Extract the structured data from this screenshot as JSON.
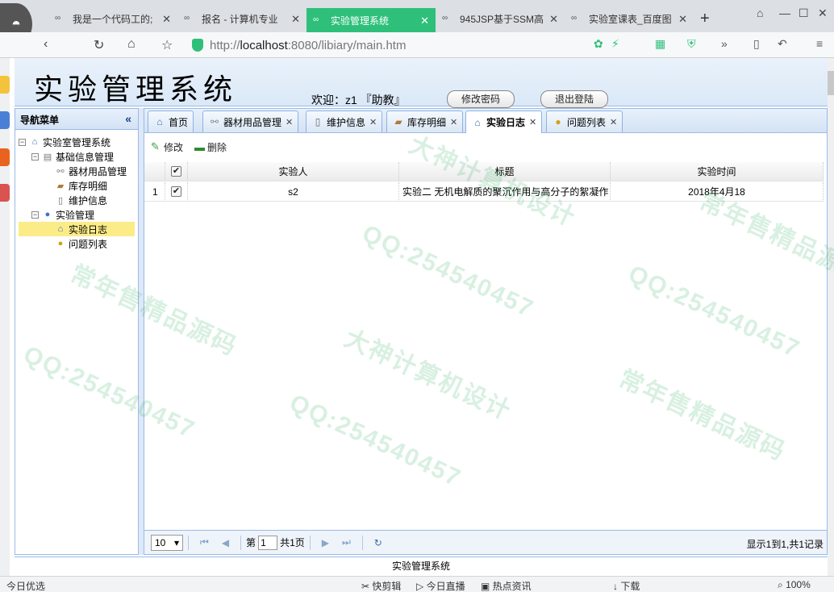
{
  "browser": {
    "tabs": [
      {
        "label": "我是一个代码工的;"
      },
      {
        "label": "报名 - 计算机专业"
      },
      {
        "label": "实验管理系统"
      },
      {
        "label": "945JSP基于SSM高"
      },
      {
        "label": "实验室课表_百度图"
      }
    ],
    "new_tab": "+",
    "url_prefix": "http://",
    "url_host": "localhost",
    "url_rest": ":8080/libiary/main.htm"
  },
  "app": {
    "title": "实验管理系统",
    "welcome": "欢迎：z1 『助教』",
    "change_password": "修改密码",
    "logout": "退出登陆",
    "footer": "实验管理系统"
  },
  "nav": {
    "header": "导航菜单",
    "collapse": "«",
    "tree": [
      {
        "label": "实验室管理系统",
        "icon": "home-icon"
      },
      {
        "label": "基础信息管理",
        "icon": "folder-icon"
      },
      {
        "label": "器材用品管理",
        "icon": "link-icon"
      },
      {
        "label": "库存明细",
        "icon": "bandage-icon"
      },
      {
        "label": "维护信息",
        "icon": "document-icon"
      },
      {
        "label": "实验管理",
        "icon": "bubble-icon"
      },
      {
        "label": "实验日志",
        "icon": "house-icon"
      },
      {
        "label": "问题列表",
        "icon": "medal-icon"
      }
    ]
  },
  "tabs": [
    {
      "label": "首页",
      "icon": "home-icon"
    },
    {
      "label": "器材用品管理",
      "icon": "link-icon"
    },
    {
      "label": "维护信息",
      "icon": "document-icon"
    },
    {
      "label": "库存明细",
      "icon": "bandage-icon"
    },
    {
      "label": "实验日志",
      "icon": "house-icon"
    },
    {
      "label": "问题列表",
      "icon": "medal-icon"
    }
  ],
  "toolbar": {
    "edit": "修改",
    "delete": "删除"
  },
  "grid": {
    "columns": [
      "实验人",
      "标题",
      "实验时间"
    ],
    "rows": [
      {
        "num": "1",
        "person": "s2",
        "title": "实验二 无机电解质的聚沉作用与高分子的絮凝作",
        "time": "2018年4月18"
      }
    ]
  },
  "pager": {
    "page_size": "10",
    "page_label": "第",
    "page": "1",
    "total_label": "共1页",
    "info": "显示1到1,共1记录"
  },
  "status": {
    "left": "今日优选",
    "items": [
      "快剪辑",
      "今日直播",
      "热点资讯",
      "下载",
      "100%"
    ]
  },
  "watermarks": [
    "QQ:254540457",
    "大神计算机设计",
    "常年售精品源码"
  ],
  "colors": {
    "accent": "#2ec07a",
    "panel_border": "#99bbe8",
    "selected": "#fbec88"
  }
}
